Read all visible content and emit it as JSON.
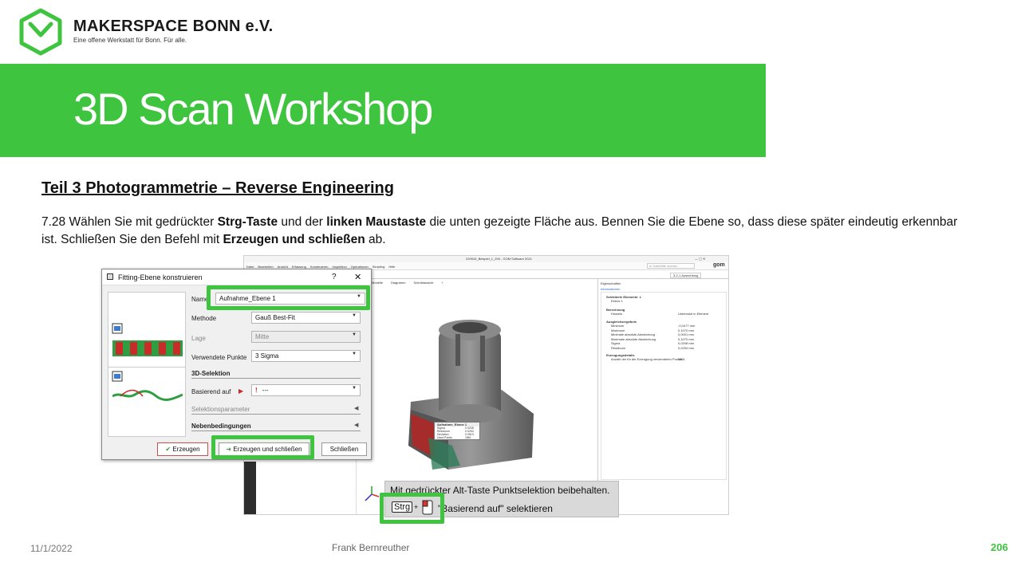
{
  "brand": {
    "name": "MAKERSPACE BONN e.V.",
    "tagline": "Eine offene Werkstatt für Bonn. Für alle."
  },
  "banner": {
    "title": "3D Scan Workshop"
  },
  "section": {
    "title": "Teil 3  Photogrammetrie  – Reverse Engineering"
  },
  "instruction": {
    "p1": "7.28 Wählen Sie mit gedrückter ",
    "b1": "Strg-Taste",
    "p2": " und der ",
    "b2": "linken Maustaste",
    "p3": " die unten gezeigte Fläche aus. Bennen Sie die Ebene so, dass diese später eindeutig erkennbar ist. Schließen Sie den Befehl mit ",
    "b3": "Erzeugen und schließen",
    "p4": " ab."
  },
  "software": {
    "window_title": "220915_Beispiel_1_200 - GOM Software 2021",
    "menu": [
      "Datei",
      "Bearbeiten",
      "Ansicht",
      "Erfassung",
      "Konstruieren",
      "Inspektion",
      "Operationen",
      "Skripting",
      "Hilfe"
    ],
    "search_placeholder": "In Dateihilfe suchen",
    "viewport_tabs": [
      "Modelle",
      "Diagramm",
      "Schnittansicht",
      "+"
    ],
    "workspace_label": "3-2-1 Ausrichtung",
    "properties_tab": "Eigenschaften",
    "properties_sub": "Informationen",
    "props": {
      "selected_header": "Selektierte Elemente: 1",
      "selected_item": "Ebene 1",
      "calc_header": "Berechnung",
      "calc_row_label": "Hinweis",
      "calc_row_value": "Unbenutzt in Element",
      "fit_header": "Ausgleichsergebnis",
      "fit_rows": [
        {
          "label": "Minimum",
          "value": "-0,0477 mm"
        },
        {
          "label": "Maximum",
          "value": "0,1070 mm"
        },
        {
          "label": "Minimale absolute Abweichung",
          "value": "0,0001 mm"
        },
        {
          "label": "Maximale absolute Abweichung",
          "value": "0,1070 mm"
        },
        {
          "label": "Sigma",
          "value": "0,0208 mm"
        },
        {
          "label": "Residuum",
          "value": "0,0294 mm"
        }
      ],
      "gen_header": "Erzeugungsdetails",
      "gen_row_label": "Anzahl der für die Erzeugung verwendeten Punkte",
      "gen_row_value": "1861"
    },
    "label_popup": {
      "title": "Aufnahme_Ebene 1",
      "rows": [
        {
          "label": "Sigma",
          "value": "0.0208"
        },
        {
          "label": "Residuum",
          "value": "0.0294"
        },
        {
          "label": "Deviation",
          "value": "0.0519"
        },
        {
          "label": "Used Points",
          "value": "1861"
        }
      ]
    },
    "hint_line1": "Mit gedrückter Alt-Taste Punktselektion beibehalten.",
    "hint_key": "Strg",
    "hint_plus": "+",
    "hint_line2": "\"Basierend auf\" selektieren"
  },
  "dialog": {
    "title": "Fitting-Ebene konstruieren",
    "help": "?",
    "close": "✕",
    "name_label": "Name",
    "name_value": "Aufnahme_Ebene 1",
    "method_label": "Methode",
    "method_value": "Gauß Best-Fit",
    "position_label": "Lage",
    "position_value": "Mitte",
    "points_label": "Verwendete Punkte",
    "points_value": "3 Sigma",
    "selection_header": "3D-Selektion",
    "based_on_label": "Basierend auf",
    "based_on_value": "---",
    "selection_params": "Selektionsparameter",
    "constraints": "Nebenbedingungen",
    "btn_create": "Erzeugen",
    "btn_create_close": "Erzeugen und schließen",
    "btn_close": "Schließen"
  },
  "footer": {
    "date": "11/1/2022",
    "author": "Frank Bernreuther",
    "page": "206"
  },
  "colors": {
    "accent": "#3ec43e",
    "banner": "#3ec43e"
  }
}
